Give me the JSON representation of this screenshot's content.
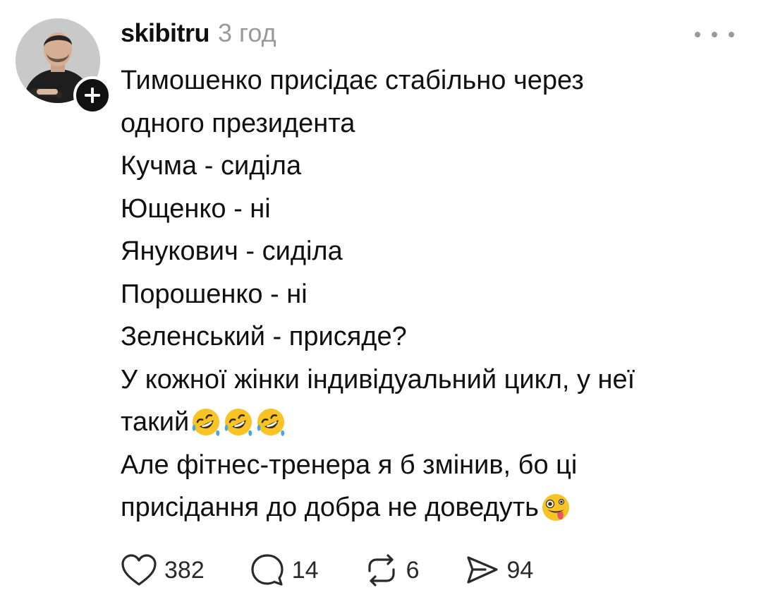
{
  "post": {
    "username": "skibitru",
    "timestamp": "3 год",
    "avatar_icon": "user-photo",
    "follow_icon": "plus-icon",
    "more_icon": "ellipsis-icon"
  },
  "body": {
    "line1": "Тимошенко присідає стабільно через",
    "line2": "одного президента",
    "line3": "Кучма - сиділа",
    "line4": "Ющенко - ні",
    "line5": "Янукович - сиділа",
    "line6": "Порошенко - ні",
    "line7": "Зеленський - присяде?",
    "line8": "У кожної жінки індивідуальний цикл, у неї",
    "line9": "такий",
    "line10": "Але фітнес-тренера я б змінив, бо ці",
    "line11": "присідання до добра не доведуть",
    "emoji_laugh": "rolling-on-floor-laughing-emoji",
    "emoji_zany": "zany-face-emoji"
  },
  "actions": {
    "likes": "382",
    "comments": "14",
    "reposts": "6",
    "shares": "94"
  },
  "colors": {
    "text": "#101010",
    "muted": "#9a9a9a",
    "emoji_face": "#f7c325"
  }
}
